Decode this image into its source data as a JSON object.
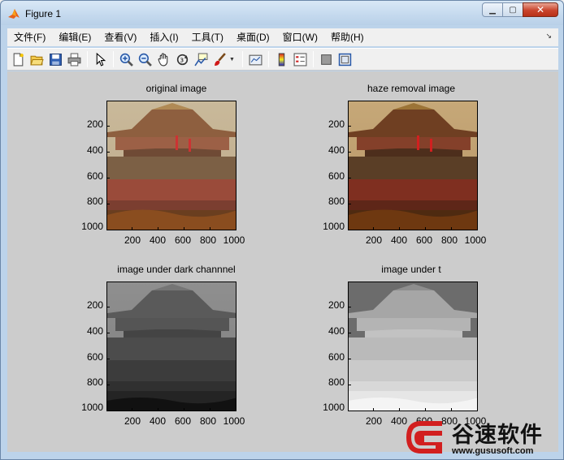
{
  "window": {
    "title": "Figure 1"
  },
  "menu": {
    "items": [
      "文件(F)",
      "编辑(E)",
      "查看(V)",
      "插入(I)",
      "工具(T)",
      "桌面(D)",
      "窗口(W)",
      "帮助(H)"
    ],
    "overflow_glyph": "↘"
  },
  "toolbar": {
    "icons": [
      "new-figure-icon",
      "open-file-icon",
      "save-icon",
      "print-icon",
      "pointer-icon",
      "zoom-in-icon",
      "zoom-out-icon",
      "pan-icon",
      "rotate-3d-icon",
      "data-cursor-icon",
      "brush-icon",
      "link-plot-icon",
      "colorbar-icon",
      "legend-icon",
      "hide-plot-tools-icon",
      "show-plot-tools-icon"
    ]
  },
  "axes": [
    {
      "title": "original image",
      "xticks": [
        "200",
        "400",
        "600",
        "800",
        "1000"
      ],
      "yticks": [
        "200",
        "400",
        "600",
        "800",
        "1000"
      ]
    },
    {
      "title": "haze removal image",
      "xticks": [
        "200",
        "400",
        "600",
        "800",
        "1000"
      ],
      "yticks": [
        "200",
        "400",
        "600",
        "800",
        "1000"
      ]
    },
    {
      "title": "image under dark channnel",
      "xticks": [
        "200",
        "400",
        "600",
        "800",
        "1000"
      ],
      "yticks": [
        "200",
        "400",
        "600",
        "800",
        "1000"
      ]
    },
    {
      "title": "image under t",
      "xticks": [
        "200",
        "400",
        "600",
        "800",
        "1000"
      ],
      "yticks": [
        "200",
        "400",
        "600",
        "800",
        "1000"
      ]
    }
  ],
  "watermark": {
    "brand": "谷速软件",
    "url": "www.gususoft.com"
  },
  "colors": {
    "figure_bg": "#cccccc",
    "close_button": "#c9452d",
    "watermark_logo": "#d21f1f"
  }
}
